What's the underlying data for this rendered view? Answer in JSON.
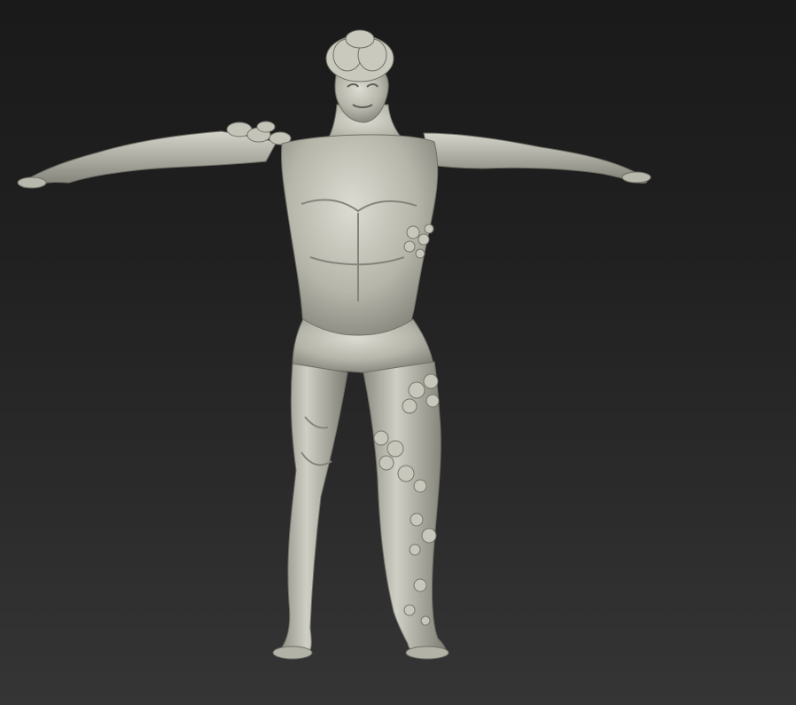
{
  "viewport": {
    "background_top": "#1a1a1a",
    "background_bottom": "#353535"
  },
  "model": {
    "subject": "creature-sculpt",
    "pose": "T-pose",
    "material_color": "#b9b9ae",
    "shadow_color": "#6f6f66",
    "highlight_color": "#deded4",
    "growth_color": "#c7c7bc"
  }
}
